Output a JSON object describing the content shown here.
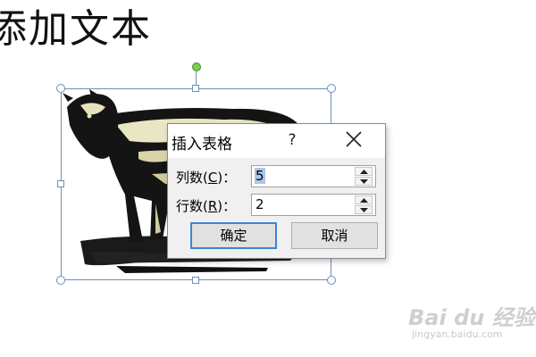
{
  "slide": {
    "title": "添加文本"
  },
  "dialog": {
    "title": "插入表格",
    "help_label": "?",
    "columns_label_prefix": "列数(",
    "columns_label_key": "C",
    "columns_label_suffix": ")：",
    "columns_value": "5",
    "rows_label_prefix": "行数(",
    "rows_label_key": "R",
    "rows_label_suffix": ")：",
    "rows_value": "2",
    "ok_label": "确定",
    "cancel_label": "取消"
  },
  "watermark": {
    "logo": "Bai du 经验",
    "url": "jingyan.baidu.com"
  },
  "colors": {
    "selection_border": "#6b8fb8",
    "rotate_handle": "#7ccf4a",
    "ok_focus_border": "#3c84d8",
    "text_selection": "#a9c7e8"
  },
  "icons": {
    "close": "close-icon",
    "spin_up": "spin-up-arrow-icon",
    "spin_down": "spin-down-arrow-icon",
    "clipart": "cow-clipart-image"
  }
}
